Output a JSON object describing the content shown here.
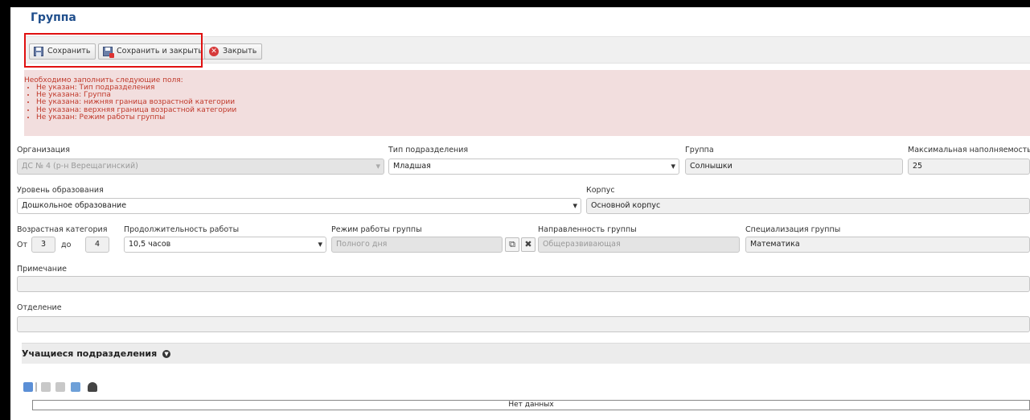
{
  "window": {
    "title": "Группа"
  },
  "toolbar": {
    "save_label": "Сохранить",
    "save_close_label": "Сохранить и закрыть",
    "close_label": "Закрыть"
  },
  "errors": {
    "header": "Необходимо заполнить следующие поля:",
    "items": [
      "Не указан: Тип подразделения",
      "Не указана: Группа",
      "Не указана: нижняя граница возрастной категории",
      "Не указана: верхняя граница возрастной категории",
      "Не указан: Режим работы группы"
    ]
  },
  "form": {
    "organization": {
      "label": "Организация",
      "value": "ДС № 4 (р-н Верещагинский)"
    },
    "unit_type": {
      "label": "Тип подразделения",
      "value": "Младшая"
    },
    "group": {
      "label": "Группа",
      "value": "Солнышки"
    },
    "max_capacity": {
      "label": "Максимальная наполняемость",
      "value": "25"
    },
    "education_level": {
      "label": "Уровень образования",
      "value": "Дошкольное образование"
    },
    "building": {
      "label": "Корпус",
      "value": "Основной корпус"
    },
    "age_category": {
      "label": "Возрастная категория",
      "from_label": "От",
      "from_value": "3",
      "to_label": "до",
      "to_value": "4"
    },
    "duration": {
      "label": "Продолжительность работы",
      "value": "10,5 часов"
    },
    "work_mode": {
      "label": "Режим работы группы",
      "value": "Полного дня"
    },
    "direction": {
      "label": "Направленность группы",
      "value": "Общеразвивающая"
    },
    "specialization": {
      "label": "Специализация группы",
      "value": "Математика"
    },
    "note": {
      "label": "Примечание",
      "value": ""
    },
    "department": {
      "label": "Отделение",
      "value": ""
    }
  },
  "students": {
    "title": "Учащиеся подразделения",
    "empty_text": "Нет данных"
  },
  "icons": {
    "expand": "chevron-circle-down-icon",
    "open": "external-link-icon",
    "clear": "x-icon"
  }
}
